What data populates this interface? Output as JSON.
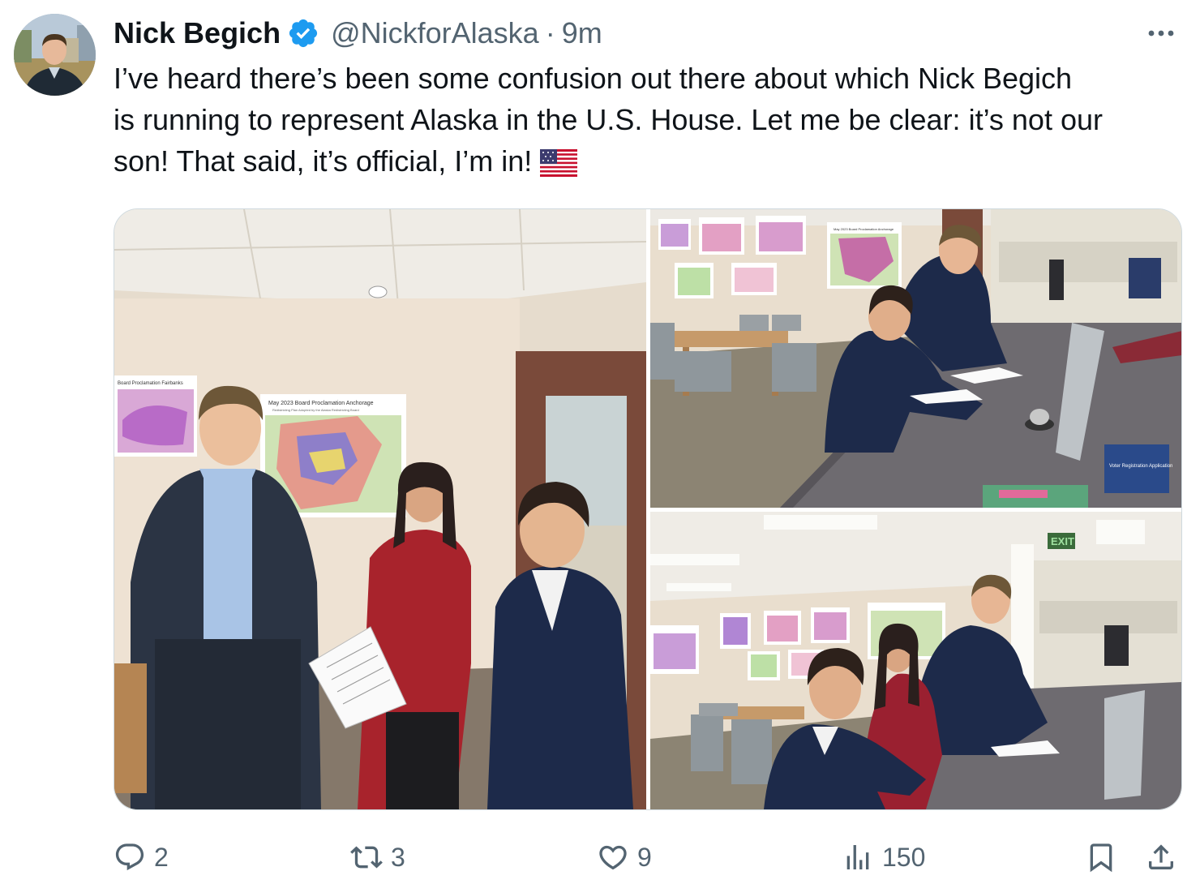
{
  "author": {
    "display_name": "Nick Begich",
    "handle": "@NickforAlaska",
    "separator": "·",
    "time": "9m",
    "verified_color": "#1d9bf0"
  },
  "tweet": {
    "text_lines": [
      "I’ve heard there’s been some confusion out there about which Nick Begich",
      "is running to represent Alaska in the U.S. House. Let me be clear: it’s not our",
      "son! That said, it’s official, I’m in!"
    ],
    "emoji": "us-flag-icon"
  },
  "media": {
    "photo1": {
      "map_title": "May 2023 Board Proclamation Anchorage",
      "map_subtitle": "Redistricting Plan Adopted by the Alaska Redistricting Board",
      "left_map_title": "Board Proclamation Fairbanks"
    },
    "photo2": {
      "map_title": "May 2023 Board Proclamation Anchorage",
      "sign_text": "Voter Registration Application"
    },
    "photo3": {
      "exit_sign": "EXIT"
    }
  },
  "actions": {
    "replies": "2",
    "reposts": "3",
    "likes": "9",
    "views": "150"
  },
  "colors": {
    "text": "#0f1419",
    "secondary": "#536471",
    "border": "#cfd9de",
    "accent": "#1d9bf0"
  },
  "icons": [
    "more-icon",
    "reply-icon",
    "repost-icon",
    "like-icon",
    "views-icon",
    "bookmark-icon",
    "share-icon",
    "verified-icon"
  ]
}
